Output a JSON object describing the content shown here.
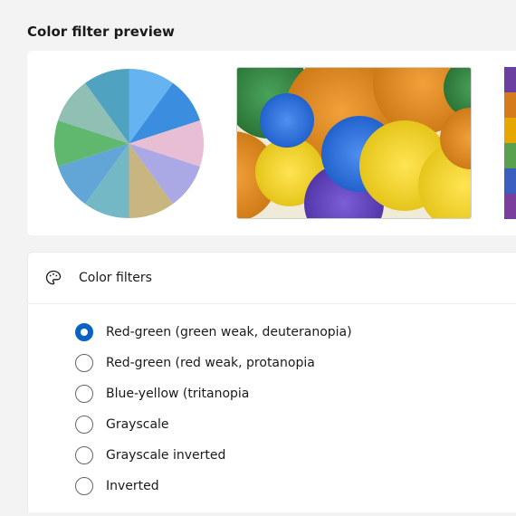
{
  "preview": {
    "title": "Color filter preview",
    "color_wheel_slices": [
      "#65b3f0",
      "#3b8de0",
      "#e7bed3",
      "#aaa9e6",
      "#c9b57f",
      "#74b8c6",
      "#61a6d6",
      "#60b86f",
      "#90bfb4",
      "#4fa3c0"
    ],
    "color_strip": [
      "#6b3fa0",
      "#d67b1c",
      "#e6a700",
      "#5aa14f",
      "#3b5fc0",
      "#7a3f9c"
    ]
  },
  "filters": {
    "header_label": "Color filters",
    "options": [
      {
        "label": "Red-green (green weak, deuteranopia)",
        "selected": true
      },
      {
        "label": "Red-green (red weak, protanopia",
        "selected": false
      },
      {
        "label": "Blue-yellow (tritanopia",
        "selected": false
      },
      {
        "label": "Grayscale",
        "selected": false
      },
      {
        "label": "Grayscale inverted",
        "selected": false
      },
      {
        "label": "Inverted",
        "selected": false
      }
    ]
  }
}
